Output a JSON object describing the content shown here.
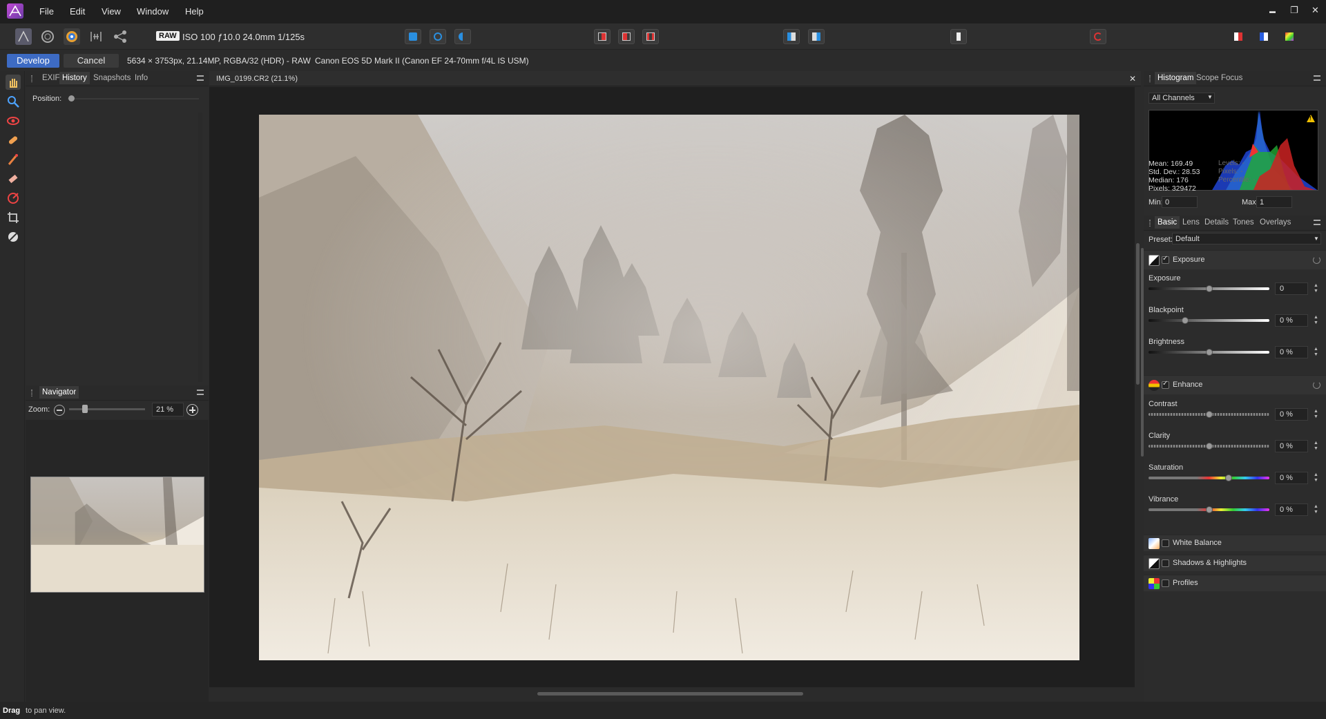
{
  "menu": {
    "items": [
      "File",
      "Edit",
      "View",
      "Window",
      "Help"
    ]
  },
  "window_controls": {
    "minimize": "▬",
    "restore": "❐",
    "close": "✕"
  },
  "toolbar": {
    "raw_badge": "RAW",
    "exif_summary": "ISO 100 ƒ10.0 24.0mm 1/125s"
  },
  "context_bar": {
    "develop_label": "Develop",
    "cancel_label": "Cancel",
    "image_info": "5634 × 3753px, 21.14MP, RGBA/32 (HDR) - RAW",
    "camera_info": "Canon EOS 5D Mark II (Canon EF 24-70mm f/4L IS USM)"
  },
  "left_panel": {
    "tabs": [
      "EXIF",
      "History",
      "Snapshots",
      "Info"
    ],
    "active_tab": "History",
    "position_label": "Position:",
    "navigator_title": "Navigator",
    "zoom_label": "Zoom:",
    "zoom_value": "21 %",
    "zoom_fraction": 0.21
  },
  "document": {
    "tab_title": "IMG_0199.CR2 (21.1%)",
    "close": "✕"
  },
  "histogram_panel": {
    "tabs": [
      "Histogram",
      "Scope",
      "Focus"
    ],
    "active_tab": "Histogram",
    "channel_select": "All Channels",
    "stats": {
      "mean": "Mean: 169.49",
      "std_dev": "Std. Dev.: 28.53",
      "median": "Median: 176",
      "pixels": "Pixels: 329472"
    },
    "dim_stats": {
      "levels": "Levels: -",
      "pixels": "Pixels: -",
      "percentile": "Percentile: -"
    },
    "min_label": "Min:",
    "min_value": "0",
    "max_label": "Max:",
    "max_value": "1",
    "warning_icon": "!"
  },
  "develop_panel": {
    "tabs": [
      "Basic",
      "Lens",
      "Details",
      "Tones",
      "Overlays"
    ],
    "active_tab": "Basic",
    "preset_label": "Preset:",
    "preset_value": "Default",
    "exposure_section": {
      "title": "Exposure",
      "checked": true,
      "sliders": [
        {
          "label": "Exposure",
          "value": "0",
          "position": 0.5
        },
        {
          "label": "Blackpoint",
          "value": "0 %",
          "position": 0.3
        },
        {
          "label": "Brightness",
          "value": "0 %",
          "position": 0.5
        }
      ]
    },
    "enhance_section": {
      "title": "Enhance",
      "checked": true,
      "sliders": [
        {
          "label": "Contrast",
          "value": "0 %",
          "position": 0.5
        },
        {
          "label": "Clarity",
          "value": "0 %",
          "position": 0.5
        },
        {
          "label": "Saturation",
          "value": "0 %",
          "position": 0.66
        },
        {
          "label": "Vibrance",
          "value": "0 %",
          "position": 0.5
        }
      ]
    },
    "collapsed_sections": [
      {
        "title": "White Balance",
        "checked": false
      },
      {
        "title": "Shadows & Highlights",
        "checked": false
      },
      {
        "title": "Profiles",
        "checked": false
      }
    ]
  },
  "status_bar": {
    "bold": "Drag",
    "text": " to pan view."
  },
  "colors": {
    "accent": "#3d6bc4",
    "panel_bg": "#2c2c2c",
    "canvas_bg": "#1f1f1f"
  }
}
